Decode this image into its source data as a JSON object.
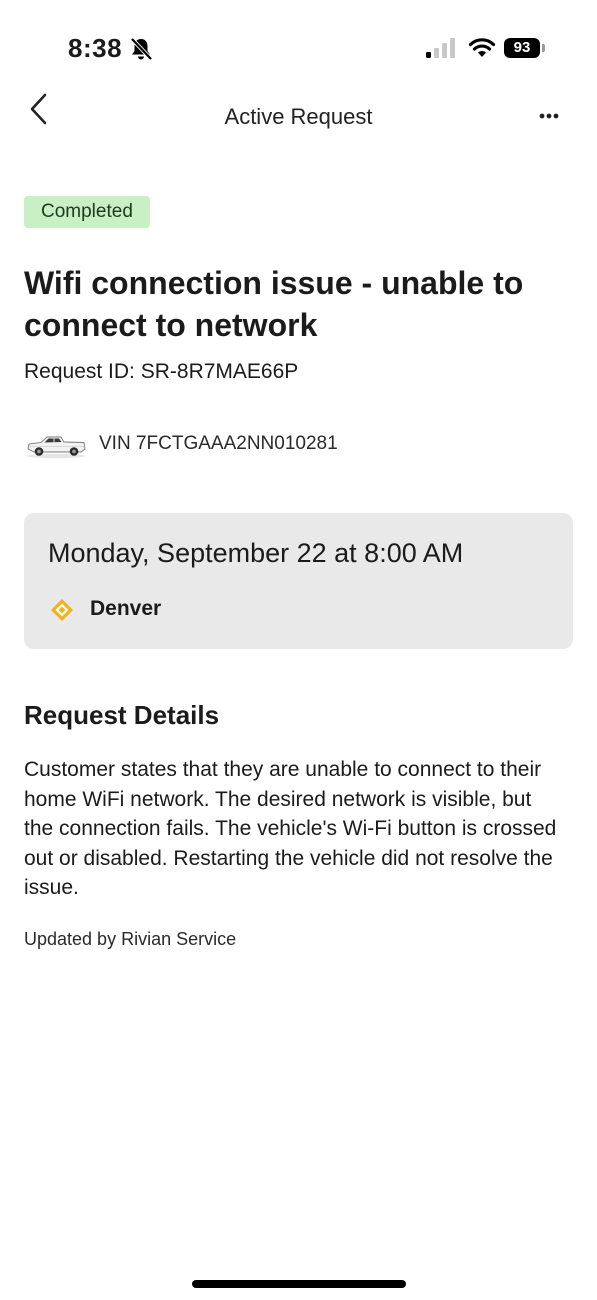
{
  "status_bar": {
    "time": "8:38",
    "battery": "93",
    "icons": [
      "bell-slash-icon",
      "cellular-signal-icon",
      "wifi-icon",
      "battery-icon"
    ]
  },
  "nav": {
    "back_icon": "chevron-left-icon",
    "title": "Active Request",
    "more_icon": "ellipsis-icon"
  },
  "request": {
    "status": "Completed",
    "status_color": "#c9efc4",
    "title": "Wifi connection issue - unable to connect to network",
    "id_label": "Request ID: SR-8R7MAE66P",
    "vin_label": "VIN 7FCTGAAA2NN010281"
  },
  "appointment": {
    "date": "Monday, September 22 at 8:00 AM",
    "location": "Denver",
    "location_icon": "rivian-diamond-icon",
    "accent_color": "#f2b21c"
  },
  "details": {
    "heading": "Request Details",
    "body": "Customer states that they are unable to connect to their home WiFi network. The desired network is visible, but the connection fails. The vehicle's Wi-Fi button is crossed out or disabled. Restarting the vehicle did not resolve the issue.",
    "updated_by": "Updated by Rivian Service"
  }
}
